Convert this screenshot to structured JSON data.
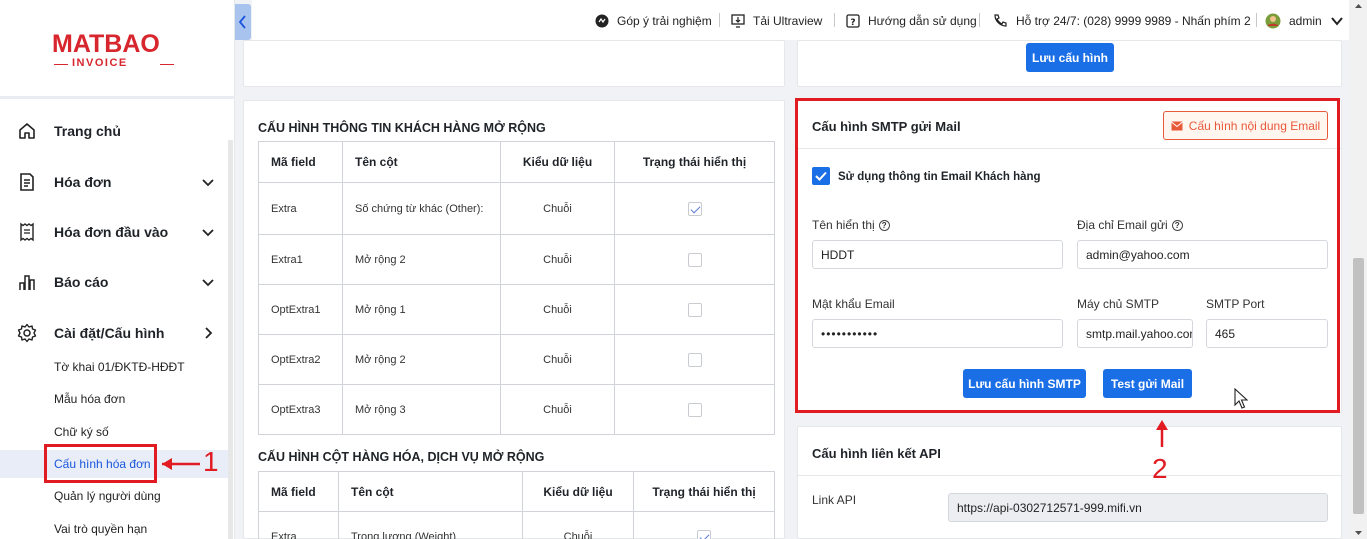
{
  "brand": {
    "name": "MATBAO",
    "sub": "INVOICE"
  },
  "topbar": {
    "feedback": "Góp ý trải nghiệm",
    "ultraview": "Tải Ultraview",
    "guide": "Hướng dẫn sử dụng",
    "support": "Hỗ trợ 24/7: (028) 9999 9989 - Nhấn phím 2",
    "user": "admin"
  },
  "sidebar": {
    "items": [
      {
        "label": "Trang chủ",
        "icon": "home-icon"
      },
      {
        "label": "Hóa đơn",
        "icon": "invoice-icon"
      },
      {
        "label": "Hóa đơn đầu vào",
        "icon": "input-invoice-icon"
      },
      {
        "label": "Báo cáo",
        "icon": "chart-icon"
      },
      {
        "label": "Cài đặt/Cấu hình",
        "icon": "gear-icon"
      }
    ],
    "subitems": [
      {
        "label": "Tờ khai 01/ĐKTĐ-HĐĐT"
      },
      {
        "label": "Mẫu hóa đơn"
      },
      {
        "label": "Chữ ký số"
      },
      {
        "label": "Cấu hình hóa đơn"
      },
      {
        "label": "Quản lý người dùng"
      },
      {
        "label": "Vai trò quyền hạn"
      }
    ]
  },
  "top_panel": {
    "save_label": "Lưu cấu hình"
  },
  "customer_ext": {
    "title": "CẤU HÌNH THÔNG TIN KHÁCH HÀNG MỞ RỘNG",
    "headers": [
      "Mã field",
      "Tên cột",
      "Kiểu dữ liệu",
      "Trạng thái hiển thị"
    ],
    "rows": [
      {
        "field": "Extra",
        "name": "Số chứng từ khác (Other):",
        "type": "Chuỗi",
        "visible": true
      },
      {
        "field": "Extra1",
        "name": "Mở rộng 2",
        "type": "Chuỗi",
        "visible": false
      },
      {
        "field": "OptExtra1",
        "name": "Mở rộng 1",
        "type": "Chuỗi",
        "visible": false
      },
      {
        "field": "OptExtra2",
        "name": "Mở rộng 2",
        "type": "Chuỗi",
        "visible": false
      },
      {
        "field": "OptExtra3",
        "name": "Mở rộng 3",
        "type": "Chuỗi",
        "visible": false
      }
    ]
  },
  "goods_ext": {
    "title": "CẤU HÌNH CỘT HÀNG HÓA, DỊCH VỤ MỞ RỘNG",
    "headers": [
      "Mã field",
      "Tên cột",
      "Kiểu dữ liệu",
      "Trạng thái hiển thị"
    ],
    "rows": [
      {
        "field": "Extra",
        "name": "Trọng lượng (Weight)",
        "type": "Chuỗi",
        "visible": true
      }
    ]
  },
  "smtp": {
    "title": "Cấu hình SMTP gửi Mail",
    "email_content_button": "Cấu hình nội dung Email",
    "use_customer_info": "Sử dụng thông tin Email Khách hàng",
    "display_name_label": "Tên hiển thị",
    "display_name_value": "HDDT",
    "sender_email_label": "Địa chỉ Email gửi",
    "sender_email_value": "admin@yahoo.com",
    "password_label": "Mật khẩu Email",
    "password_value": "•••••••••••",
    "server_label": "Máy chủ SMTP",
    "server_value": "smtp.mail.yahoo.com",
    "port_label": "SMTP Port",
    "port_value": "465",
    "save_button": "Lưu cấu hình SMTP",
    "test_button": "Test gửi Mail"
  },
  "api": {
    "title": "Cấu hình liên kết API",
    "link_label": "Link API",
    "link_value": "https://api-0302712571-999.mifi.vn"
  },
  "annotations": {
    "one": "1",
    "two": "2"
  },
  "colors": {
    "accent": "#1a6fe6",
    "brand": "#d7262d",
    "annotation": "#e11b22",
    "outline": "#e8593a"
  }
}
